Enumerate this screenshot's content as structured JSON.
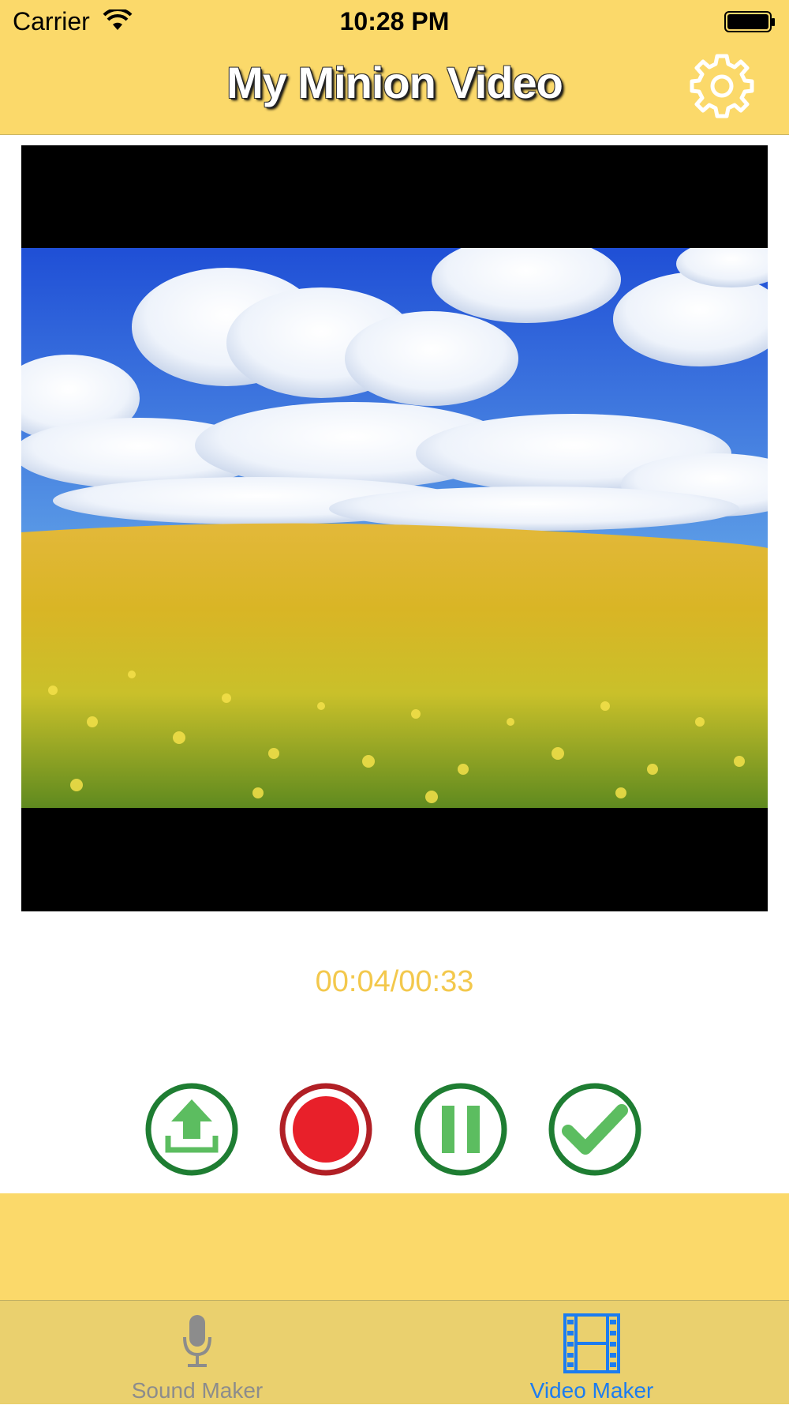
{
  "status_bar": {
    "carrier": "Carrier",
    "time": "10:28 PM"
  },
  "header": {
    "title": "My Minion Video",
    "settings_icon": "gear-icon"
  },
  "player": {
    "timecode": "00:04/00:33",
    "frame_description_icon": "video-frame"
  },
  "controls": {
    "upload_icon": "upload-icon",
    "record_icon": "record-icon",
    "pause_icon": "pause-icon",
    "done_icon": "checkmark-icon"
  },
  "tabs": [
    {
      "label": "Sound Maker",
      "icon": "microphone-icon",
      "selected": false
    },
    {
      "label": "Video Maker",
      "icon": "film-icon",
      "selected": true
    }
  ],
  "colors": {
    "header_bg": "#fbd96a",
    "timecode": "#f3c84c",
    "control_green": "#1e7d32",
    "control_green_fill": "#5cbd60",
    "record_red": "#e8202a",
    "record_ring": "#b11f25",
    "tab_selected": "#1c7cf0",
    "tab_unselected": "#8c8c8c"
  }
}
